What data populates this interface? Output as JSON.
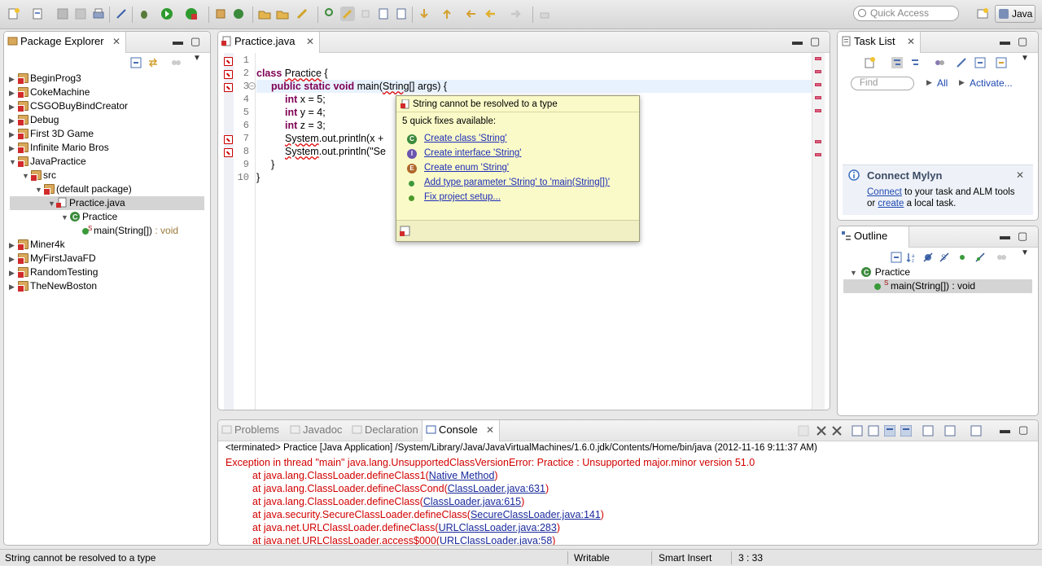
{
  "toolbar": {
    "quick_access_placeholder": "Quick Access",
    "perspective": "Java"
  },
  "package_explorer": {
    "title": "Package Explorer",
    "items": [
      {
        "label": "BeginProg3",
        "level": 0,
        "expanded": false
      },
      {
        "label": "CokeMachine",
        "level": 0,
        "expanded": false
      },
      {
        "label": "CSGOBuyBindCreator",
        "level": 0,
        "expanded": false
      },
      {
        "label": "Debug",
        "level": 0,
        "expanded": false
      },
      {
        "label": "First 3D Game",
        "level": 0,
        "expanded": false
      },
      {
        "label": "Infinite Mario Bros",
        "level": 0,
        "expanded": false
      },
      {
        "label": "JavaPractice",
        "level": 0,
        "expanded": true
      },
      {
        "label": "src",
        "level": 1,
        "expanded": true
      },
      {
        "label": "(default package)",
        "level": 2,
        "expanded": true
      },
      {
        "label": "Practice.java",
        "level": 3,
        "expanded": true,
        "selected": true
      },
      {
        "label": "Practice",
        "level": 4,
        "expanded": true
      },
      {
        "label": "main(String[])",
        "suffix": " : void",
        "level": 5
      },
      {
        "label": "Miner4k",
        "level": 0,
        "expanded": false
      },
      {
        "label": "MyFirstJavaFD",
        "level": 0,
        "expanded": false
      },
      {
        "label": "RandomTesting",
        "level": 0,
        "expanded": false
      },
      {
        "label": "TheNewBoston",
        "level": 0,
        "expanded": false
      }
    ]
  },
  "editor": {
    "tab_label": "Practice.java",
    "line_numbers": [
      "1",
      "2",
      "3",
      "4",
      "5",
      "6",
      "7",
      "8",
      "9",
      "10"
    ],
    "lines": [
      "",
      "class Practice {",
      "public static void main(String[] args) {",
      "int x = 5;",
      "int y = 4;",
      "int z = 3;",
      "System.out.println(x +",
      "System.out.println(\"Se",
      "}",
      "}"
    ]
  },
  "quick_fix": {
    "message": "String cannot be resolved to a type",
    "count_label": "5 quick fixes available:",
    "fixes": [
      {
        "label": "Create class 'String'",
        "icon": "class-icon",
        "color": "#3b8a3b"
      },
      {
        "label": "Create interface 'String'",
        "icon": "interface-icon",
        "color": "#6a55b0"
      },
      {
        "label": "Create enum 'String'",
        "icon": "enum-icon",
        "color": "#b0662a"
      },
      {
        "label": "Add type parameter 'String' to 'main(String[])'",
        "icon": "type-param-icon",
        "color": "#3d9a3d"
      },
      {
        "label": "Fix project setup...",
        "icon": "fix-setup-icon",
        "color": "#4c9a2a"
      }
    ]
  },
  "task_list": {
    "title": "Task List",
    "find_placeholder": "Find",
    "all_label": "All",
    "activate_label": "Activate...",
    "mylyn_title": "Connect Mylyn",
    "mylyn_connect": "Connect",
    "mylyn_text1": " to your task and ALM tools",
    "mylyn_or": "or ",
    "mylyn_create": "create",
    "mylyn_text2": " a local task."
  },
  "outline": {
    "title": "Outline",
    "class_label": "Practice",
    "method_label": "main(String[]) : void"
  },
  "console": {
    "tabs": [
      {
        "label": "Problems",
        "active": false
      },
      {
        "label": "Javadoc",
        "active": false
      },
      {
        "label": "Declaration",
        "active": false
      },
      {
        "label": "Console",
        "active": true
      }
    ],
    "terminated": "<terminated> Practice [Java Application] /System/Library/Java/JavaVirtualMachines/1.6.0.jdk/Contents/Home/bin/java (2012-11-16 9:11:37 AM)",
    "exception": "Exception in thread \"main\" java.lang.UnsupportedClassVersionError: Practice : Unsupported major.minor version 51.0",
    "stack": [
      {
        "prefix": "at java.lang.ClassLoader.defineClass1(",
        "link": "Native Method",
        "suffix": ")"
      },
      {
        "prefix": "at java.lang.ClassLoader.defineClassCond(",
        "link": "ClassLoader.java:631",
        "suffix": ")"
      },
      {
        "prefix": "at java.lang.ClassLoader.defineClass(",
        "link": "ClassLoader.java:615",
        "suffix": ")"
      },
      {
        "prefix": "at java.security.SecureClassLoader.defineClass(",
        "link": "SecureClassLoader.java:141",
        "suffix": ")"
      },
      {
        "prefix": "at java.net.URLClassLoader.defineClass(",
        "link": "URLClassLoader.java:283",
        "suffix": ")"
      },
      {
        "prefix": "at java.net.URLClassLoader.access$000(",
        "link": "URLClassLoader.java:58",
        "suffix": ")"
      }
    ]
  },
  "status_bar": {
    "message": "String cannot be resolved to a type",
    "writable": "Writable",
    "insert_mode": "Smart Insert",
    "position": "3 : 33"
  },
  "colors": {
    "error_red": "#d10000",
    "keyword": "#7f0055",
    "link_blue": "#1e2db8",
    "quickfix_bg": "#fafac8"
  }
}
